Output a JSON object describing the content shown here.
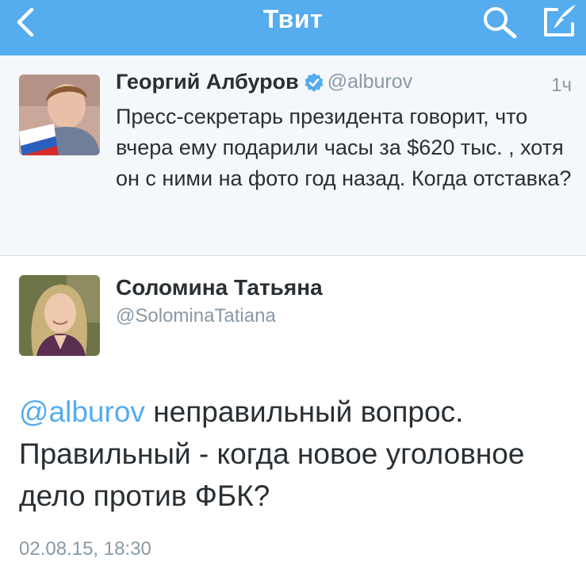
{
  "nav": {
    "title": "Твит",
    "back_icon": "chevron-left-icon",
    "search_icon": "search-icon",
    "compose_icon": "compose-icon",
    "bar_color": "#55acee"
  },
  "parent_tweet": {
    "name": "Георгий Албуров",
    "verified": true,
    "handle": "@alburov",
    "time": "1ч",
    "text": "Пресс-секретарь президента говорит, что вчера ему подарили часы за $620 тыс. , хотя он с ними на фото год назад. Когда отставка?"
  },
  "main_tweet": {
    "name": "Соломина Татьяна",
    "handle": "@SolominaTatiana",
    "mention": "@alburov",
    "text": " неправильный вопрос. Правильный - когда новое уголовное дело против ФБК?",
    "date": "02.08.15, 18:30"
  },
  "colors": {
    "link": "#55acee",
    "text": "#292f33",
    "secondary": "#8899a6",
    "parent_bg": "#f5f8fa"
  }
}
